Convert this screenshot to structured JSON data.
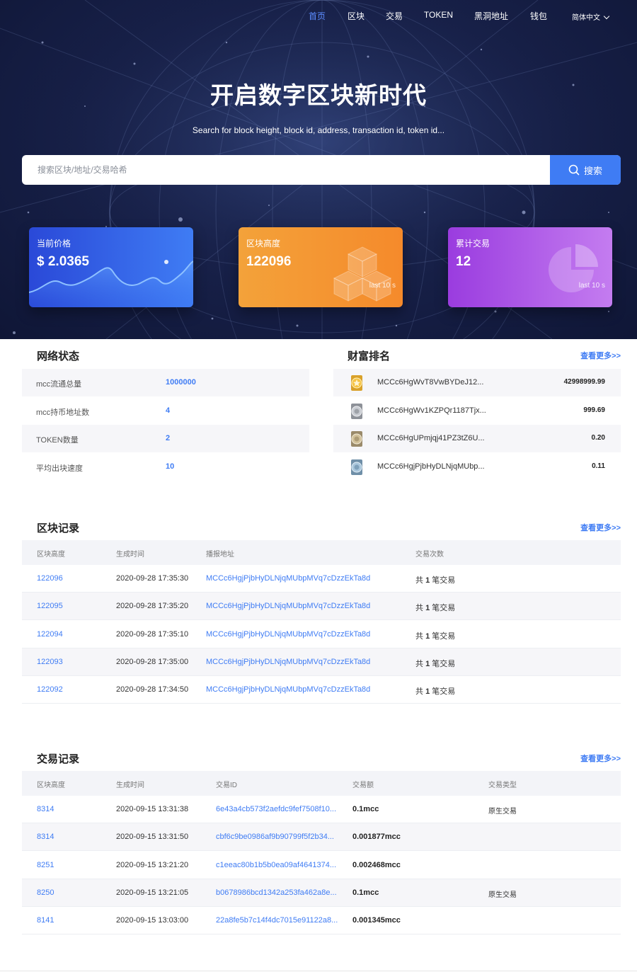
{
  "nav": {
    "items": [
      "首页",
      "区块",
      "交易",
      "TOKEN",
      "黑洞地址",
      "钱包"
    ],
    "active_index": 0,
    "language": "简体中文"
  },
  "hero": {
    "title": "开启数字区块新时代",
    "subtitle": "Search for block height, block id, address, transaction id, token id...",
    "search_placeholder": "搜索区块/地址/交易哈希",
    "search_button": "搜索"
  },
  "cards": [
    {
      "label": "当前价格",
      "value": "$ 2.0365",
      "note": ""
    },
    {
      "label": "区块高度",
      "value": "122096",
      "note": "last 10 s"
    },
    {
      "label": "累计交易",
      "value": "12",
      "note": "last 10 s"
    }
  ],
  "network": {
    "title": "网络状态",
    "rows": [
      {
        "label": "mcc流通总量",
        "value": "1000000"
      },
      {
        "label": "mcc持币地址数",
        "value": "4"
      },
      {
        "label": "TOKEN数量",
        "value": "2"
      },
      {
        "label": "平均出块速度",
        "value": "10"
      }
    ]
  },
  "wealth": {
    "title": "财富排名",
    "more": "查看更多>>",
    "rows": [
      {
        "address": "MCCc6HgWvT8VwBYDeJ12...",
        "amount": "42998999.99",
        "medal": "gold"
      },
      {
        "address": "MCCc6HgWv1KZPQr1187Tjx...",
        "amount": "999.69",
        "medal": "silver"
      },
      {
        "address": "MCCc6HgUPmjqj41PZ3tZ6U...",
        "amount": "0.20",
        "medal": "bronze"
      },
      {
        "address": "MCCc6HgjPjbHyDLNjqMUbp...",
        "amount": "0.11",
        "medal": "blue"
      }
    ]
  },
  "blocks": {
    "title": "区块记录",
    "more": "查看更多>>",
    "headers": [
      "区块高度",
      "生成时间",
      "播报地址",
      "交易次数"
    ],
    "rows": [
      {
        "height": "122096",
        "time": "2020-09-28 17:35:30",
        "address": "MCCc6HgjPjbHyDLNjqMUbpMVq7cDzzEkTa8d",
        "tx_prefix": "共",
        "tx_count": "1",
        "tx_suffix": "笔交易"
      },
      {
        "height": "122095",
        "time": "2020-09-28 17:35:20",
        "address": "MCCc6HgjPjbHyDLNjqMUbpMVq7cDzzEkTa8d",
        "tx_prefix": "共",
        "tx_count": "1",
        "tx_suffix": "笔交易"
      },
      {
        "height": "122094",
        "time": "2020-09-28 17:35:10",
        "address": "MCCc6HgjPjbHyDLNjqMUbpMVq7cDzzEkTa8d",
        "tx_prefix": "共",
        "tx_count": "1",
        "tx_suffix": "笔交易"
      },
      {
        "height": "122093",
        "time": "2020-09-28 17:35:00",
        "address": "MCCc6HgjPjbHyDLNjqMUbpMVq7cDzzEkTa8d",
        "tx_prefix": "共",
        "tx_count": "1",
        "tx_suffix": "笔交易"
      },
      {
        "height": "122092",
        "time": "2020-09-28 17:34:50",
        "address": "MCCc6HgjPjbHyDLNjqMUbpMVq7cDzzEkTa8d",
        "tx_prefix": "共",
        "tx_count": "1",
        "tx_suffix": "笔交易"
      }
    ]
  },
  "transactions": {
    "title": "交易记录",
    "more": "查看更多>>",
    "headers": [
      "区块高度",
      "生成时间",
      "交易ID",
      "交易额",
      "交易类型"
    ],
    "rows": [
      {
        "height": "8314",
        "time": "2020-09-15 13:31:38",
        "txid": "6e43a4cb573f2aefdc9fef7508f10...",
        "amount": "0.1mcc",
        "type": "原生交易"
      },
      {
        "height": "8314",
        "time": "2020-09-15 13:31:50",
        "txid": "cbf6c9be0986af9b90799f5f2b34...",
        "amount": "0.001877mcc",
        "type": ""
      },
      {
        "height": "8251",
        "time": "2020-09-15 13:21:20",
        "txid": "c1eeac80b1b5b0ea09af4641374...",
        "amount": "0.002468mcc",
        "type": ""
      },
      {
        "height": "8250",
        "time": "2020-09-15 13:21:05",
        "txid": "b0678986bcd1342a253fa462a8e...",
        "amount": "0.1mcc",
        "type": "原生交易"
      },
      {
        "height": "8141",
        "time": "2020-09-15 13:03:00",
        "txid": "22a8fe5b7c14f4dc7015e91122a8...",
        "amount": "0.001345mcc",
        "type": ""
      }
    ]
  }
}
